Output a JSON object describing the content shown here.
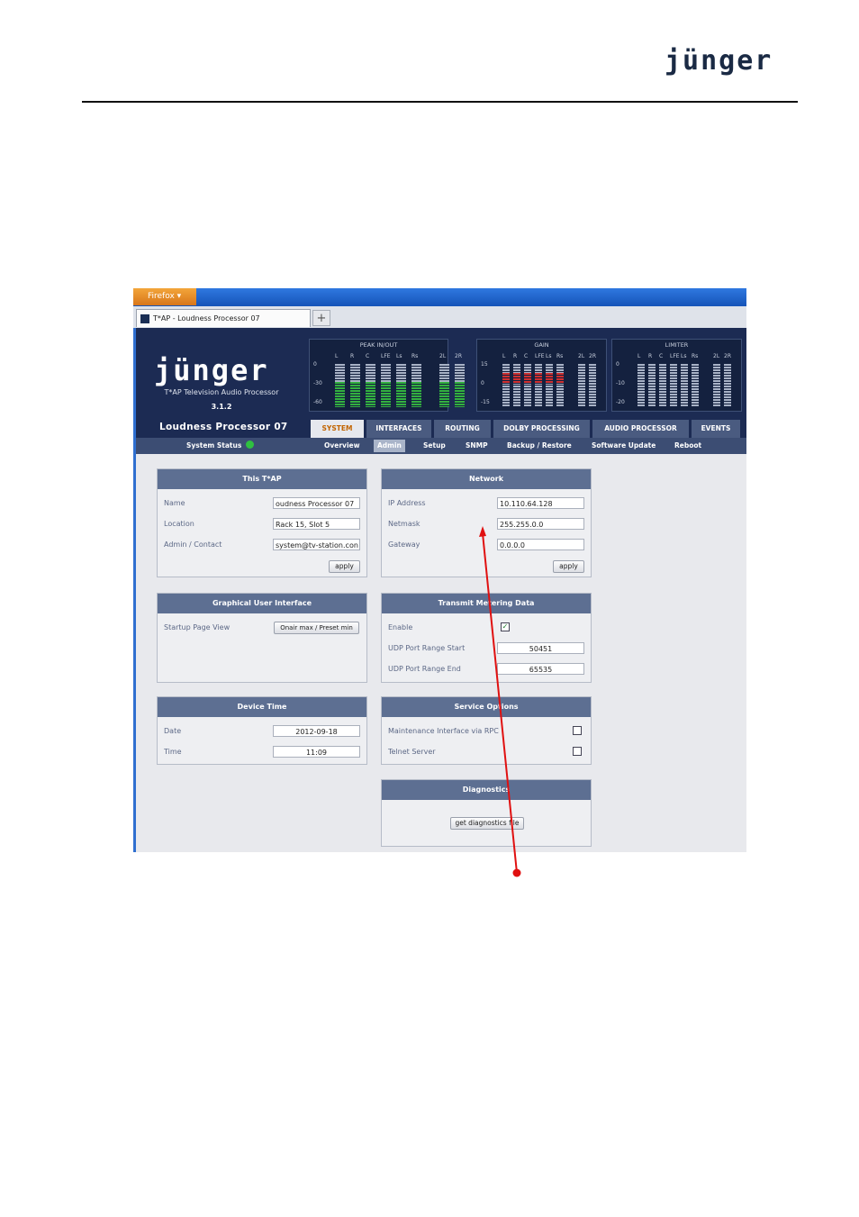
{
  "document": {
    "logo": "jünger"
  },
  "browser": {
    "menu_label": "Firefox",
    "tab_title": "T*AP - Loudness Processor 07",
    "new_tab": "+"
  },
  "header": {
    "logo": "jünger",
    "tagline": "T*AP Television Audio Processor",
    "version": "3.1.2",
    "device_name": "Loudness Processor 07",
    "meters": [
      {
        "title": "PEAK IN/OUT",
        "channels": [
          "L",
          "R",
          "C",
          "LFE",
          "Ls",
          "Rs",
          "2L",
          "2R"
        ],
        "scale": [
          "0",
          "-30",
          "-60"
        ]
      },
      {
        "title": "GAIN",
        "channels": [
          "L",
          "R",
          "C",
          "LFE",
          "Ls",
          "Rs",
          "2L",
          "2R"
        ],
        "scale": [
          "15",
          "0",
          "-15"
        ]
      },
      {
        "title": "LIMITER",
        "channels": [
          "L",
          "R",
          "C",
          "LFE",
          "Ls",
          "Rs",
          "2L",
          "2R"
        ],
        "scale": [
          "0",
          "-10",
          "-20"
        ]
      }
    ]
  },
  "nav": {
    "tabs": [
      "SYSTEM",
      "INTERFACES",
      "ROUTING",
      "DOLBY PROCESSING",
      "AUDIO PROCESSOR",
      "EVENTS"
    ],
    "active_tab": "SYSTEM",
    "system_status": "System Status",
    "subtabs": [
      "Overview",
      "Admin",
      "Setup",
      "SNMP",
      "Backup / Restore",
      "Software Update",
      "Reboot"
    ],
    "active_subtab": "Admin"
  },
  "panels": {
    "this_tap": {
      "title": "This T*AP",
      "name_label": "Name",
      "name_value": "oudness Processor 07",
      "location_label": "Location",
      "location_value": "Rack 15, Slot 5",
      "admin_label": "Admin / Contact",
      "admin_value": "system@tv-station.con",
      "apply": "apply"
    },
    "network": {
      "title": "Network",
      "ip_label": "IP Address",
      "ip_value": "10.110.64.128",
      "netmask_label": "Netmask",
      "netmask_value": "255.255.0.0",
      "gateway_label": "Gateway",
      "gateway_value": "0.0.0.0",
      "apply": "apply"
    },
    "gui": {
      "title": "Graphical User Interface",
      "startup_label": "Startup Page View",
      "startup_value": "Onair max / Preset min"
    },
    "metering": {
      "title": "Transmit Metering Data",
      "enable_label": "Enable",
      "enable_checked": true,
      "udp_start_label": "UDP Port Range Start",
      "udp_start_value": "50451",
      "udp_end_label": "UDP Port Range End",
      "udp_end_value": "65535"
    },
    "device_time": {
      "title": "Device Time",
      "date_label": "Date",
      "date_value": "2012-09-18",
      "time_label": "Time",
      "time_value": "11:09"
    },
    "service": {
      "title": "Service Options",
      "maintenance_label": "Maintenance Interface via RPC",
      "maintenance_checked": false,
      "telnet_label": "Telnet Server",
      "telnet_checked": false
    },
    "diagnostics": {
      "title": "Diagnostics",
      "button": "get diagnostics file"
    }
  },
  "annotation_color": "#e01010"
}
